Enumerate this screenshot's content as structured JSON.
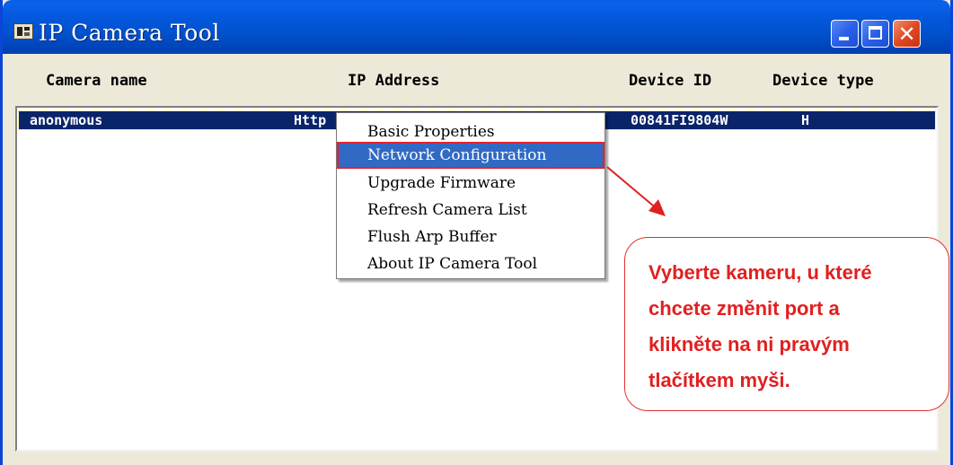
{
  "window": {
    "title": "IP Camera Tool",
    "title_icon": "app-icon",
    "controls": {
      "minimize": "minimize-icon",
      "maximize": "maximize-icon",
      "close": "✕"
    }
  },
  "columns": {
    "camera_name": "Camera name",
    "ip_address": "IP Address",
    "device_id": "Device ID",
    "device_type": "Device type"
  },
  "cameras": [
    {
      "name": "anonymous",
      "ip": "Http",
      "device_id": "00841FI9804W",
      "device_type": "H"
    }
  ],
  "context_menu": {
    "items": [
      "Basic Properties",
      "Network Configuration",
      "Upgrade Firmware",
      "Refresh Camera List",
      "Flush Arp Buffer",
      "About IP Camera Tool"
    ],
    "highlighted_index": 1
  },
  "annotation": {
    "lines": [
      "Vyberte kameru, u které",
      "chcete změnit port a",
      "klikněte na ni pravým",
      "tlačítkem myši."
    ]
  },
  "colors": {
    "titlebar": "#0054e3",
    "selection": "#0a246a",
    "menu_highlight": "#316ac5",
    "annotation_red": "#e02020"
  }
}
